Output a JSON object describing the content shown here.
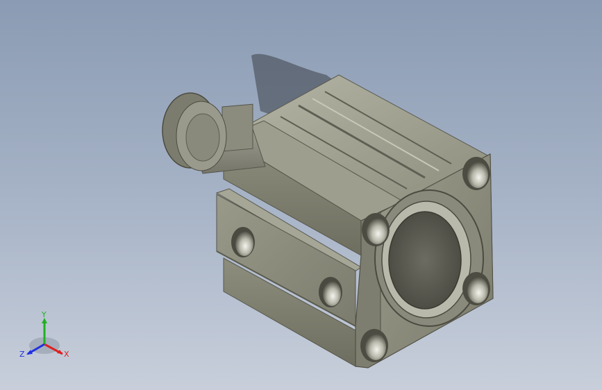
{
  "viewport": {
    "background_top": "#8a9bb3",
    "background_bottom": "#c8cfdb"
  },
  "model": {
    "body_color": "#8f8f80",
    "icon": "pneumatic-cylinder-model"
  },
  "triad": {
    "x_label": "X",
    "y_label": "Y",
    "z_label": "Z",
    "x_color": "#e02020",
    "y_color": "#20b020",
    "z_color": "#2030e0"
  }
}
